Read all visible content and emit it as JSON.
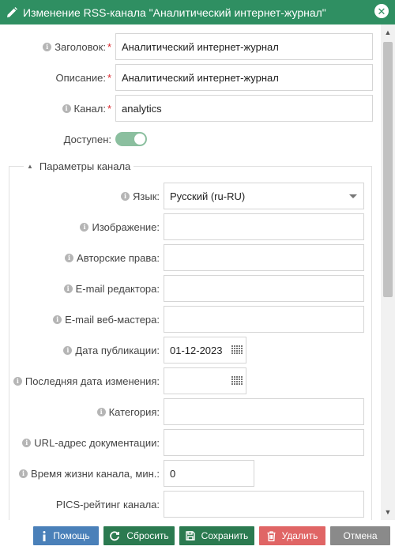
{
  "window": {
    "title": "Изменение RSS-канала \"Аналитический интернет-журнал\"",
    "close_glyph": "✕"
  },
  "main": {
    "title_label": "Заголовок:",
    "title_value": "Аналитический интернет-журнал",
    "description_label": "Описание:",
    "description_value": "Аналитический интернет-журнал",
    "channel_label": "Канал:",
    "channel_value": "analytics",
    "available_label": "Доступен:",
    "available_on": true,
    "required_mark": "*"
  },
  "params": {
    "legend": "Параметры канала",
    "language_label": "Язык:",
    "language_value": "Русский (ru-RU)",
    "image_label": "Изображение:",
    "image_value": "",
    "copyright_label": "Авторские права:",
    "copyright_value": "",
    "editor_email_label": "E-mail редактора:",
    "editor_email_value": "",
    "webmaster_email_label": "E-mail веб-мастера:",
    "webmaster_email_value": "",
    "pub_date_label": "Дата публикации:",
    "pub_date_value": "01-12-2023",
    "last_build_label": "Последняя дата изменения:",
    "last_build_value": "",
    "category_label": "Категория:",
    "category_value": "",
    "docs_label": "URL-адрес документации:",
    "docs_value": "",
    "ttl_label": "Время жизни канала, мин.:",
    "ttl_value": "0",
    "pics_label": "PICS-рейтинг канала:",
    "pics_value": ""
  },
  "footer": {
    "help": "Помощь",
    "reset": "Сбросить",
    "save": "Сохранить",
    "delete": "Удалить",
    "cancel": "Отмена"
  },
  "colors": {
    "titlebar": "#2f8f62",
    "help": "#4a80b9",
    "reset": "#2b7a50",
    "save": "#2b7a50",
    "delete": "#e06565",
    "cancel": "#8a8a8a"
  }
}
